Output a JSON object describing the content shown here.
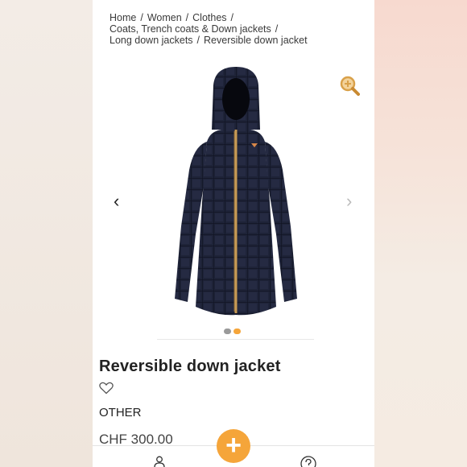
{
  "breadcrumb": {
    "items": [
      "Home",
      "Women",
      "Clothes",
      "Coats, Trench coats & Down jackets",
      "Long down jackets",
      "Reversible down jacket"
    ],
    "separator": "/"
  },
  "gallery": {
    "prev_icon": "chevron-left-icon",
    "next_icon": "chevron-right-icon",
    "zoom_icon": "zoom-in-icon",
    "dots": [
      {
        "color": "#9a9a9a"
      },
      {
        "color": "#f5a53a"
      }
    ]
  },
  "product": {
    "title": "Reversible down jacket",
    "brand": "OTHER",
    "price": "CHF 300.00"
  },
  "bottom_nav": {
    "add_label": "+",
    "account_icon": "user-icon",
    "help_icon": "help-icon"
  },
  "colors": {
    "accent": "#f5a53a",
    "jacket": "#1c2135",
    "zipper": "#c79a55"
  }
}
